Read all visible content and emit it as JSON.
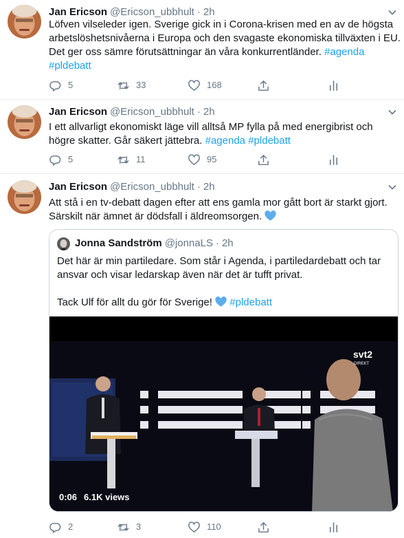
{
  "tweets": [
    {
      "name": "Jan Ericson",
      "handle": "@Ericson_ubbhult",
      "sep": "·",
      "time": "2h",
      "lines": [
        "Löfven vilseleder igen. Sverige gick in i Corona-krisen med en av de högsta",
        "arbetslöshetsnivåerna i Europa och den svagaste ekonomiska tillväxten i EU.",
        "Det ger oss sämre förutsättningar än våra konkurrentländer."
      ],
      "tag1": "#agenda",
      "tag2": "#pldebatt",
      "replies": "5",
      "retweets": "33",
      "likes": "168"
    },
    {
      "name": "Jan Ericson",
      "handle": "@Ericson_ubbhult",
      "sep": "·",
      "time": "2h",
      "lines": [
        "I ett allvarligt ekonomiskt läge vill alltså MP fylla på med energibrist och",
        "högre skatter. Går säkert jättebra."
      ],
      "tag1": "#agenda",
      "tag2": "#pldebatt",
      "replies": "5",
      "retweets": "11",
      "likes": "95"
    },
    {
      "name": "Jan Ericson",
      "handle": "@Ericson_ubbhult",
      "sep": "·",
      "time": "2h",
      "lines": [
        "Att stå i en tv-debatt dagen efter att ens gamla mor gått bort är starkt gjort.",
        "Särskilt när ämnet är dödsfall i äldreomsorgen."
      ],
      "replies": "2",
      "retweets": "3",
      "likes": "110"
    }
  ],
  "quote": {
    "name": "Jonna Sandström",
    "handle": "@jonnaLS",
    "sep": "·",
    "time": "2h",
    "lines": [
      "Det här är min partiledare. Som står i Agenda, i partiledardebatt och tar",
      "ansvar och visar ledarskap även när det är tufft privat.",
      "Tack Ulf för allt du gör för Sverige!"
    ],
    "tag": "#pldebatt",
    "video_time": "0:06",
    "video_views": "6.1K views",
    "video_logo": "svt2",
    "video_logo_sub": "DIREKT"
  },
  "icons": {
    "reply": "reply-icon",
    "retweet": "retweet-icon",
    "like": "heart-icon",
    "share": "share-icon",
    "analytics": "analytics-icon",
    "caret": "chevron-down-icon",
    "emoji": "blue-heart-emoji"
  },
  "colors": {
    "link": "#1da1f2",
    "secondary": "#657786",
    "border": "#e6ecf0",
    "emoji_heart": "#5dadec"
  }
}
